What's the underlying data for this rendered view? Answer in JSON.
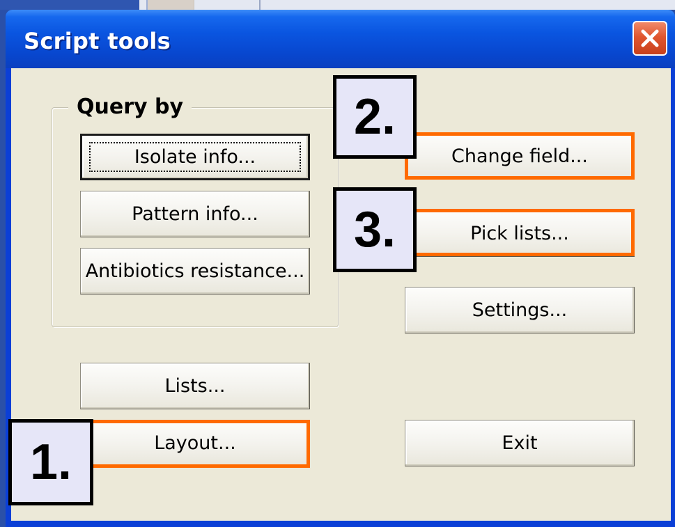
{
  "window": {
    "title": "Script tools",
    "close_icon": "close-x-icon"
  },
  "query_group": {
    "label": "Query by",
    "buttons": [
      {
        "label": "Isolate info...",
        "default": true
      },
      {
        "label": "Pattern info..."
      },
      {
        "label": "Antibiotics resistance..."
      }
    ]
  },
  "right_buttons": {
    "change_field": "Change field...",
    "pick_lists": "Pick lists...",
    "settings": "Settings..."
  },
  "bottom_buttons": {
    "lists": "Lists...",
    "layout": "Layout...",
    "exit": "Exit"
  },
  "callouts": {
    "one": "1.",
    "two": "2.",
    "three": "3."
  },
  "colors": {
    "highlight": "#ff6a00",
    "callout_bg": "#e6e6f8",
    "dialog_bg": "#ece9d8",
    "titlebar": "#0a55e0"
  }
}
